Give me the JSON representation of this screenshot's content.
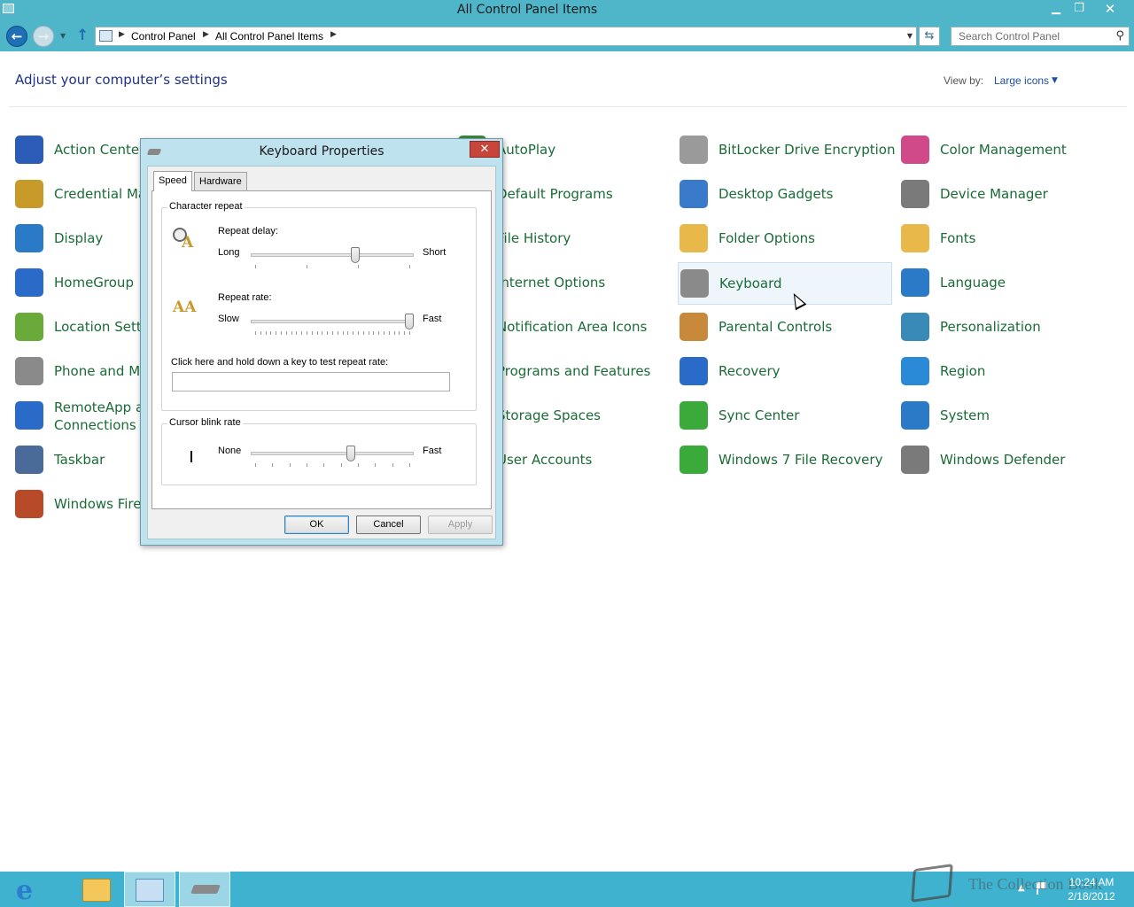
{
  "window": {
    "title": "All Control Panel Items",
    "minimize": "▁",
    "maximize": "❐",
    "close": "✕"
  },
  "nav": {
    "back": "←",
    "forward": "→",
    "up": "↑",
    "breadcrumbs": [
      "Control Panel",
      "All Control Panel Items"
    ],
    "search_placeholder": "Search Control Panel"
  },
  "content": {
    "heading": "Adjust your computer’s settings",
    "view_by_label": "View by:",
    "view_by_value": "Large icons"
  },
  "items": [
    {
      "label": "Action Center",
      "icon": "action-center-icon",
      "color": "#2a5cb8"
    },
    {
      "label": "AutoPlay",
      "icon": "autoplay-icon",
      "color": "#3a8a3a"
    },
    {
      "label": "BitLocker Drive Encryption",
      "icon": "bitlocker-icon",
      "color": "#9a9a9a"
    },
    {
      "label": "Color Management",
      "icon": "color-management-icon",
      "color": "#d04a8a"
    },
    {
      "label": "Credential Manager",
      "icon": "credential-manager-icon",
      "color": "#c89a2a"
    },
    {
      "label": "Default Programs",
      "icon": "default-programs-icon",
      "color": "#3a8a3a"
    },
    {
      "label": "Desktop Gadgets",
      "icon": "desktop-gadgets-icon",
      "color": "#3a7acb"
    },
    {
      "label": "Device Manager",
      "icon": "device-manager-icon",
      "color": "#7a7a7a"
    },
    {
      "label": "Display",
      "icon": "display-icon",
      "color": "#2a7ac8"
    },
    {
      "label": "File History",
      "icon": "file-history-icon",
      "color": "#e0a020"
    },
    {
      "label": "Folder Options",
      "icon": "folder-options-icon",
      "color": "#e8b84a"
    },
    {
      "label": "Fonts",
      "icon": "fonts-icon",
      "color": "#e8b84a"
    },
    {
      "label": "HomeGroup",
      "icon": "homegroup-icon",
      "color": "#2a6ac8"
    },
    {
      "label": "Internet Options",
      "icon": "internet-options-icon",
      "color": "#2a8ad8"
    },
    {
      "label": "Keyboard",
      "icon": "keyboard-icon",
      "color": "#8a8a8a"
    },
    {
      "label": "Language",
      "icon": "language-icon",
      "color": "#2a7ac8"
    },
    {
      "label": "Location Settings",
      "icon": "location-settings-icon",
      "color": "#6aaa3a"
    },
    {
      "label": "Notification Area Icons",
      "icon": "notification-area-icon",
      "color": "#5a9acb"
    },
    {
      "label": "Parental Controls",
      "icon": "parental-controls-icon",
      "color": "#c88a3a"
    },
    {
      "label": "Personalization",
      "icon": "personalization-icon",
      "color": "#3a8ab8"
    },
    {
      "label": "Phone and Modem",
      "icon": "phone-modem-icon",
      "color": "#8a8a8a"
    },
    {
      "label": "Programs and Features",
      "icon": "programs-features-icon",
      "color": "#6a8ab8"
    },
    {
      "label": "Recovery",
      "icon": "recovery-icon",
      "color": "#2a6ac8"
    },
    {
      "label": "Region",
      "icon": "region-icon",
      "color": "#2a8ad8"
    },
    {
      "label": "RemoteApp and Desktop Connections",
      "label_line1": "RemoteApp and Desktop",
      "label_line2": "Connections",
      "icon": "remoteapp-icon",
      "color": "#2a6ac8"
    },
    {
      "label": "Storage Spaces",
      "icon": "storage-spaces-icon",
      "color": "#7a7a7a"
    },
    {
      "label": "Sync Center",
      "icon": "sync-center-icon",
      "color": "#3aaa3a"
    },
    {
      "label": "System",
      "icon": "system-icon",
      "color": "#2a7ac8"
    },
    {
      "label": "Taskbar",
      "icon": "taskbar-icon",
      "color": "#4a6a9a"
    },
    {
      "label": "User Accounts",
      "icon": "user-accounts-icon",
      "color": "#3a8ab8"
    },
    {
      "label": "Windows 7 File Recovery",
      "icon": "windows7-file-recovery-icon",
      "color": "#3aaa3a"
    },
    {
      "label": "Windows Defender",
      "icon": "windows-defender-icon",
      "color": "#7a7a7a"
    },
    {
      "label": "Windows Firewall",
      "icon": "windows-firewall-icon",
      "color": "#b84a2a"
    }
  ],
  "dialog": {
    "title": "Keyboard Properties",
    "close": "✕",
    "tabs": [
      "Speed",
      "Hardware"
    ],
    "active_tab": "Speed",
    "character_repeat": {
      "label": "Character repeat",
      "repeat_delay_label": "Repeat delay:",
      "repeat_delay_min": "Long",
      "repeat_delay_max": "Short",
      "repeat_delay_level": 0.65,
      "repeat_rate_label": "Repeat rate:",
      "repeat_rate_min": "Slow",
      "repeat_rate_max": "Fast",
      "repeat_rate_level": 1.0,
      "test_label": "Click here and hold down a key to test repeat rate:",
      "test_value": ""
    },
    "cursor_blink": {
      "label": "Cursor blink rate",
      "min": "None",
      "max": "Fast",
      "level": 0.62
    },
    "buttons": {
      "ok": "OK",
      "cancel": "Cancel",
      "apply": "Apply"
    }
  },
  "taskbar": {
    "time": "10:24 AM",
    "date": "2/18/2012",
    "watermark": "The Collection Book"
  }
}
